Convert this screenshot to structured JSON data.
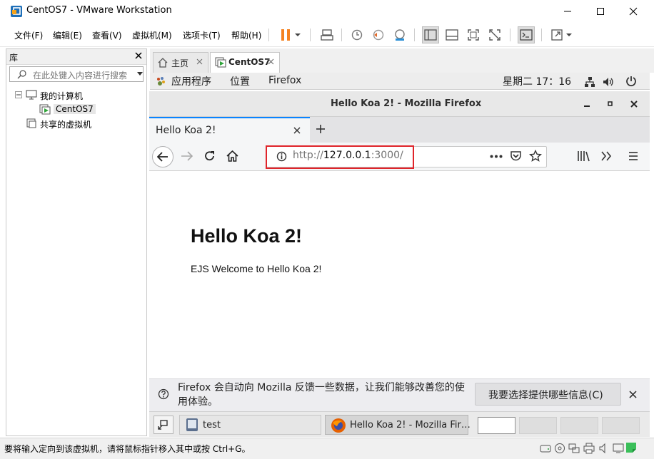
{
  "window": {
    "title": "CentOS7 - VMware Workstation",
    "menu": [
      "文件(F)",
      "编辑(E)",
      "查看(V)",
      "虚拟机(M)",
      "选项卡(T)",
      "帮助(H)"
    ]
  },
  "library": {
    "title": "库",
    "search_placeholder": "在此处键入内容进行搜索",
    "tree": {
      "my_computer": "我的计算机",
      "vm": "CentOS7",
      "shared": "共享的虚拟机"
    }
  },
  "vm_tabs": [
    {
      "label": "主页"
    },
    {
      "label": "CentOS7"
    }
  ],
  "guest": {
    "top_bar": {
      "applications": "应用程序",
      "places": "位置",
      "app_name": "Firefox",
      "clock": "星期二 17：16"
    },
    "firefox": {
      "window_title": "Hello Koa 2! - Mozilla Firefox",
      "tab_title": "Hello Koa 2!",
      "url_prefix": "http://",
      "url_host": "127.0.0.1",
      "url_port": ":3000/",
      "page_heading": "Hello Koa 2!",
      "page_text": "EJS Welcome to Hello Koa 2!",
      "notification_text": "Firefox 会自动向 Mozilla 反馈一些数据，让我们能够改善您的使用体验。",
      "notification_button": "我要选择提供哪些信息(C)"
    },
    "taskbar": {
      "item1": "test",
      "item2": "Hello Koa 2! - Mozilla Fir…"
    }
  },
  "status": {
    "text": "要将输入定向到该虚拟机，请将鼠标指针移入其中或按 Ctrl+G。"
  },
  "colors": {
    "pause_orange": "#f58220",
    "highlight_red": "#e0242a",
    "firefox_tab_blue": "#0a84ff"
  }
}
